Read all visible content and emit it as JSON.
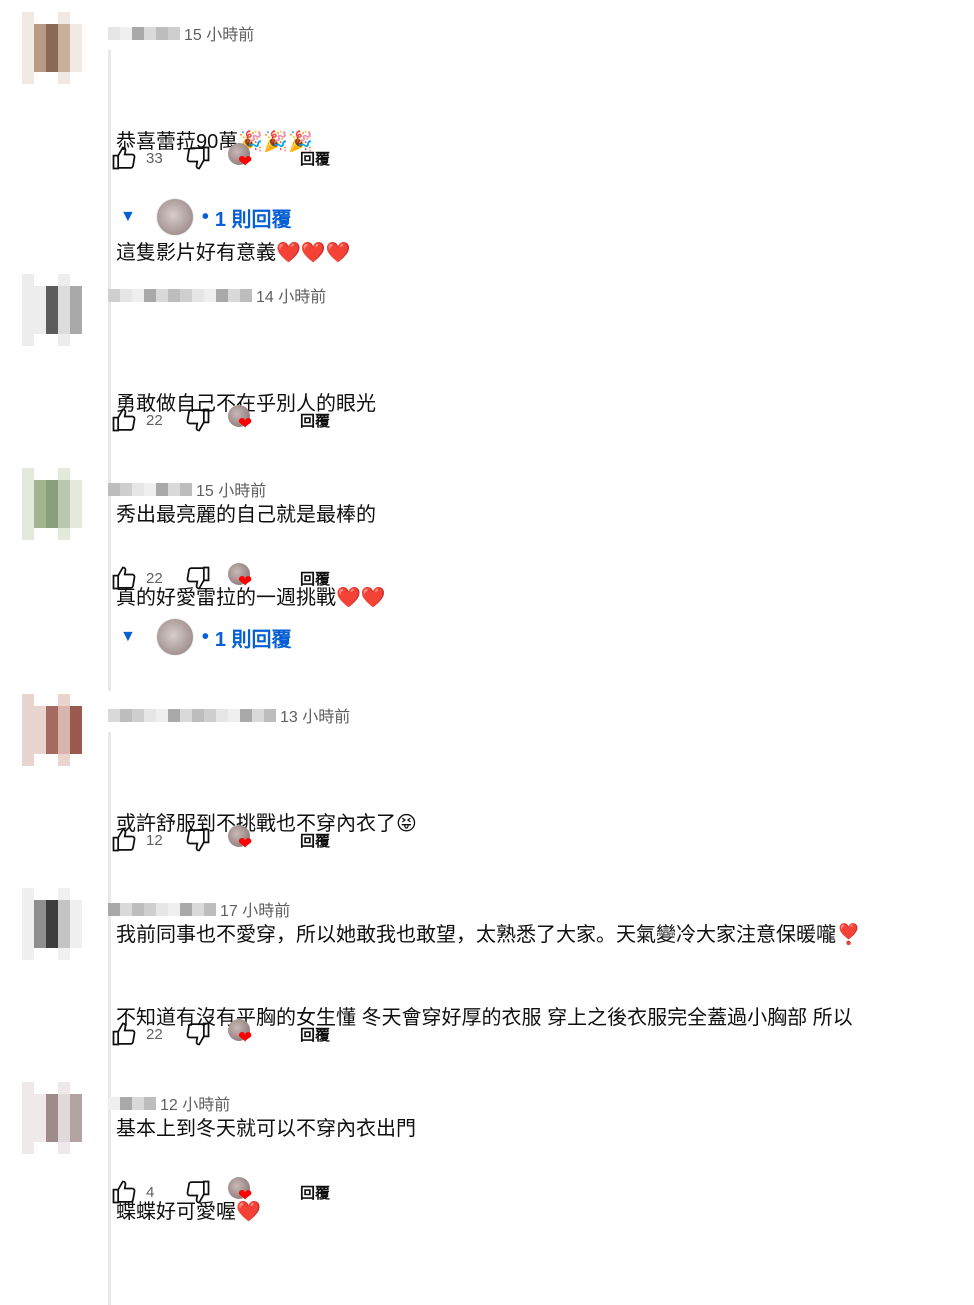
{
  "comments": [
    {
      "time": "15 小時前",
      "lines": [
        "恭喜蕾菈90萬🎉🎉🎉",
        "這隻影片好有意義❤️❤️❤️"
      ],
      "likes": "33",
      "reply_label": "回覆",
      "replies_label": "1 則回覆"
    },
    {
      "time": "14 小時前",
      "lines": [
        "勇敢做自己不在乎別人的眼光",
        "秀出最亮麗的自己就是最棒的"
      ],
      "likes": "22",
      "reply_label": "回覆"
    },
    {
      "time": "15 小時前",
      "lines": [
        "真的好愛雷拉的一週挑戰❤️❤️"
      ],
      "likes": "22",
      "reply_label": "回覆",
      "replies_label": "1 則回覆"
    },
    {
      "time": "13 小時前",
      "lines": [
        "或許舒服到不挑戰也不穿內衣了😝",
        "我前同事也不愛穿，所以她敢我也敢望，太熟悉了大家。天氣變冷大家注意保暖嚨❣️"
      ],
      "likes": "12",
      "reply_label": "回覆"
    },
    {
      "time": "17 小時前",
      "lines": [
        "不知道有沒有平胸的女生懂 冬天會穿好厚的衣服 穿上之後衣服完全蓋過小胸部 所以",
        "基本上到冬天就可以不穿內衣出門"
      ],
      "likes": "22",
      "reply_label": "回覆"
    },
    {
      "time": "12 小時前",
      "lines": [
        "蝶蝶好可愛喔❤️"
      ],
      "likes": "4",
      "reply_label": "回覆"
    }
  ],
  "icons": {
    "like": "thumb-up-icon",
    "dislike": "thumb-down-icon",
    "creator_heart": "heart-icon",
    "expand": "caret-down-icon"
  },
  "colors": {
    "link_blue": "#065fd4",
    "heart_red": "#ff0000",
    "meta_gray": "#606060"
  }
}
